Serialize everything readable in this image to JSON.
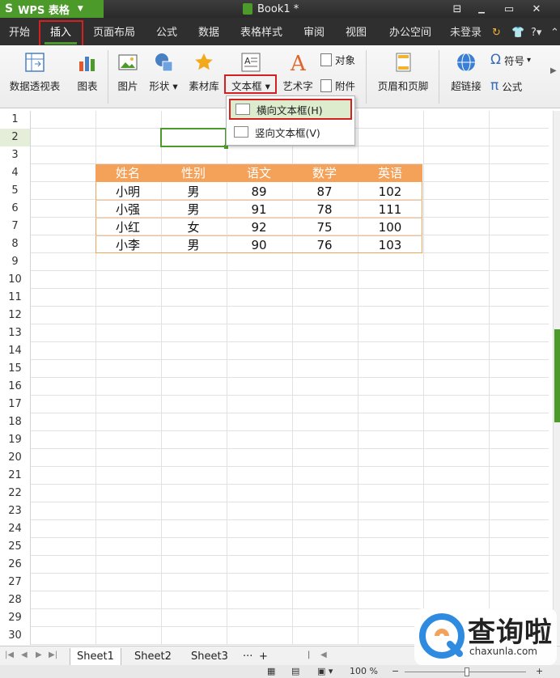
{
  "titlebar": {
    "app_logo": "S",
    "app_name": "WPS 表格",
    "doc_title": "Book1 *",
    "buttons": [
      "minimize",
      "restore",
      "maximize",
      "close"
    ]
  },
  "tabs": [
    "开始",
    "插入",
    "页面布局",
    "公式",
    "数据",
    "表格样式",
    "审阅",
    "视图",
    "办公空间"
  ],
  "active_tab": "插入",
  "tabbar_right": {
    "login": "未登录",
    "help": "?"
  },
  "ribbon": {
    "pivot": "数据透视表",
    "chart": "图表",
    "picture": "图片",
    "shapes": "形状",
    "library": "素材库",
    "textbox": "文本框",
    "wordart": "艺术字",
    "object": "对象",
    "attachment": "附件",
    "header_footer": "页眉和页脚",
    "hyperlink": "超链接",
    "symbol": "符号",
    "formula": "公式"
  },
  "textbox_menu": {
    "horizontal": "横向文本框(H)",
    "vertical": "竖向文本框(V)"
  },
  "grid": {
    "row_numbers": [
      "1",
      "2",
      "3",
      "4",
      "5",
      "6",
      "7",
      "8",
      "9",
      "10",
      "11",
      "12",
      "13",
      "14",
      "15",
      "16",
      "17",
      "18",
      "19",
      "20",
      "21",
      "22",
      "23",
      "24",
      "25",
      "26",
      "27",
      "28",
      "29",
      "30"
    ],
    "selected_row": "2"
  },
  "table": {
    "headers": [
      "姓名",
      "性别",
      "语文",
      "数学",
      "英语"
    ],
    "rows": [
      [
        "小明",
        "男",
        "89",
        "87",
        "102"
      ],
      [
        "小强",
        "男",
        "91",
        "78",
        "111"
      ],
      [
        "小红",
        "女",
        "92",
        "75",
        "100"
      ],
      [
        "小李",
        "男",
        "90",
        "76",
        "103"
      ]
    ]
  },
  "sheets": [
    "Sheet1",
    "Sheet2",
    "Sheet3"
  ],
  "active_sheet": "Sheet1",
  "sheet_more": "···",
  "sheet_add": "+",
  "status": {
    "zoom": "100 %",
    "minus": "−",
    "plus": "+"
  },
  "watermark": {
    "title": "查询啦",
    "url": "chaxunla.com"
  },
  "colors": {
    "accent_green": "#4c9a2a",
    "table_header": "#f4a259",
    "highlight_red": "#d32020"
  }
}
